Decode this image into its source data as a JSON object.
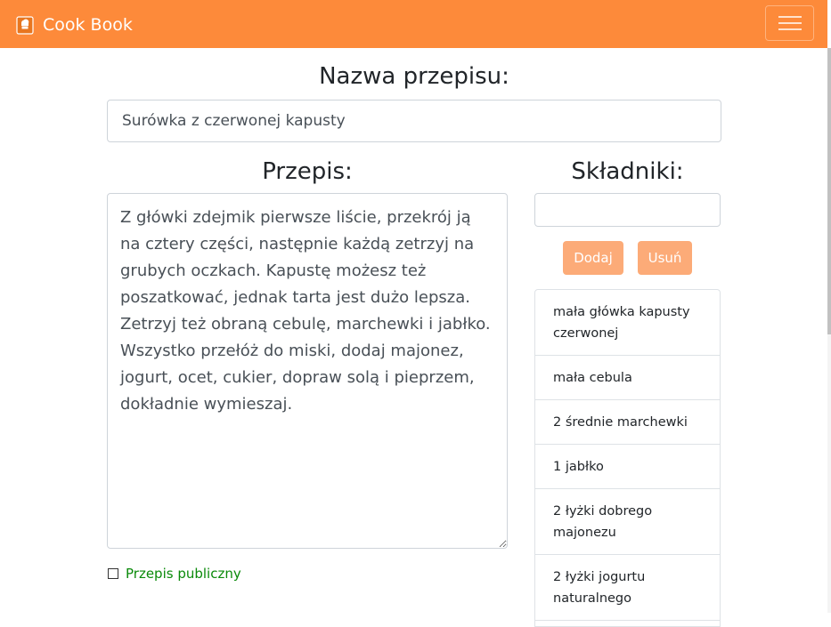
{
  "navbar": {
    "brand": "Cook Book",
    "logo_icon": "cookbook-logo-icon",
    "menu_icon": "hamburger-menu-icon",
    "background": "#fd8a3a"
  },
  "form": {
    "name_title": "Nazwa przepisu:",
    "name_value": "Surówka z czerwonej kapusty",
    "recipe_title": "Przepis:",
    "recipe_text": "Z główki zdejmik pierwsze liście, przekrój ją na cztery części, następnie każdą zetrzyj na grubych oczkach. Kapustę możesz też poszatkować, jednak tarta jest dużo lepsza. Zetrzyj też obraną cebulę, marchewki i jabłko. Wszystko przełóż do miski, dodaj majonez, jogurt, ocet, cukier, dopraw solą i pieprzem, dokładnie wymieszaj.",
    "public_label": "Przepis publiczny",
    "public_checked": false
  },
  "ingredients": {
    "title": "Składniki:",
    "input_value": "",
    "add_label": "Dodaj",
    "remove_label": "Usuń",
    "button_color": "#fcab78",
    "items": [
      "mała główka kapusty czerwonej",
      "mała cebula",
      "2 średnie marchewki",
      "1 jabłko",
      "2 łyżki dobrego majonezu",
      "2 łyżki jogurtu naturalnego"
    ]
  }
}
